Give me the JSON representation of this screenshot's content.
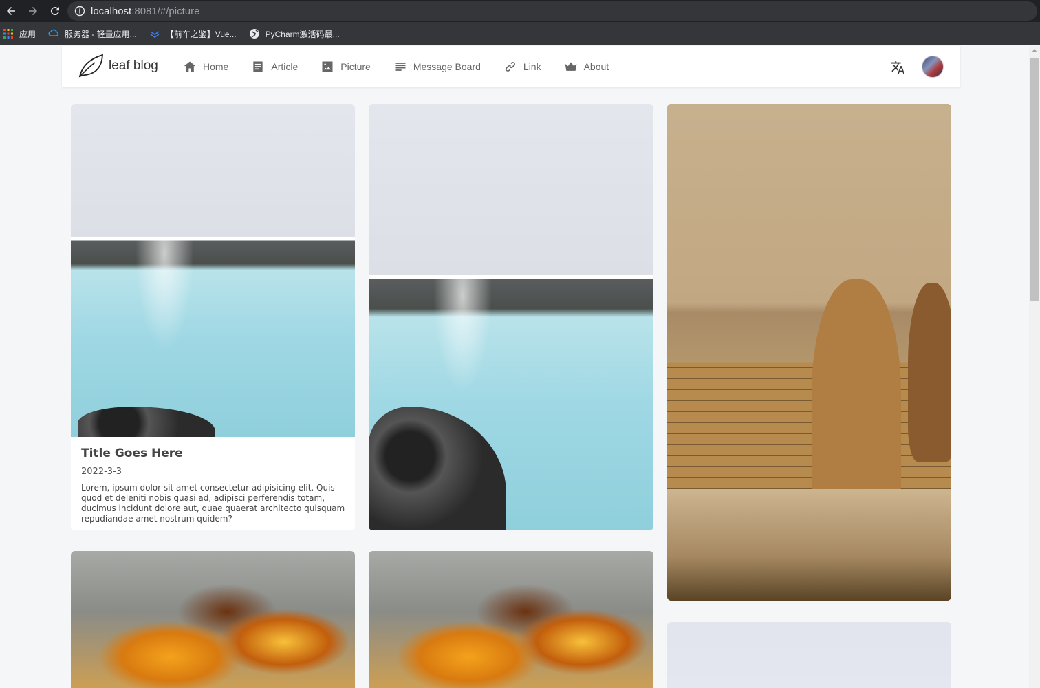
{
  "browser": {
    "url_host": "localhost",
    "url_rest": ":8081/#/picture",
    "bookmarks": [
      {
        "label": "应用",
        "icon": "apps-grid-icon"
      },
      {
        "label": "服务器 - 轻量应用...",
        "icon": "cloud-icon"
      },
      {
        "label": "【前车之鉴】Vue...",
        "icon": "dev-site-icon"
      },
      {
        "label": "PyCharm激活码最...",
        "icon": "globe-icon"
      }
    ]
  },
  "site": {
    "logo_text": "leaf blog",
    "menu": [
      {
        "label": "Home",
        "icon": "home-icon"
      },
      {
        "label": "Article",
        "icon": "article-icon"
      },
      {
        "label": "Picture",
        "icon": "picture-icon"
      },
      {
        "label": "Message Board",
        "icon": "message-board-icon"
      },
      {
        "label": "Link",
        "icon": "link-icon"
      },
      {
        "label": "About",
        "icon": "crown-icon"
      }
    ]
  },
  "cards": [
    {
      "title": "Title Goes Here",
      "date": "2022-3-3",
      "description": "Lorem, ipsum dolor sit amet consectetur adipisicing elit. Quis quod et deleniti nobis quasi ad, adipisci perferendis totam, ducimus incidunt dolore aut, quae quaerat architecto quisquam repudiandae amet nostrum quidem?"
    }
  ],
  "colors": {
    "page_bg": "#f5f6f8",
    "browser_bar": "#202124",
    "bookmark_bar": "#35363a",
    "nav_text": "#666666"
  }
}
